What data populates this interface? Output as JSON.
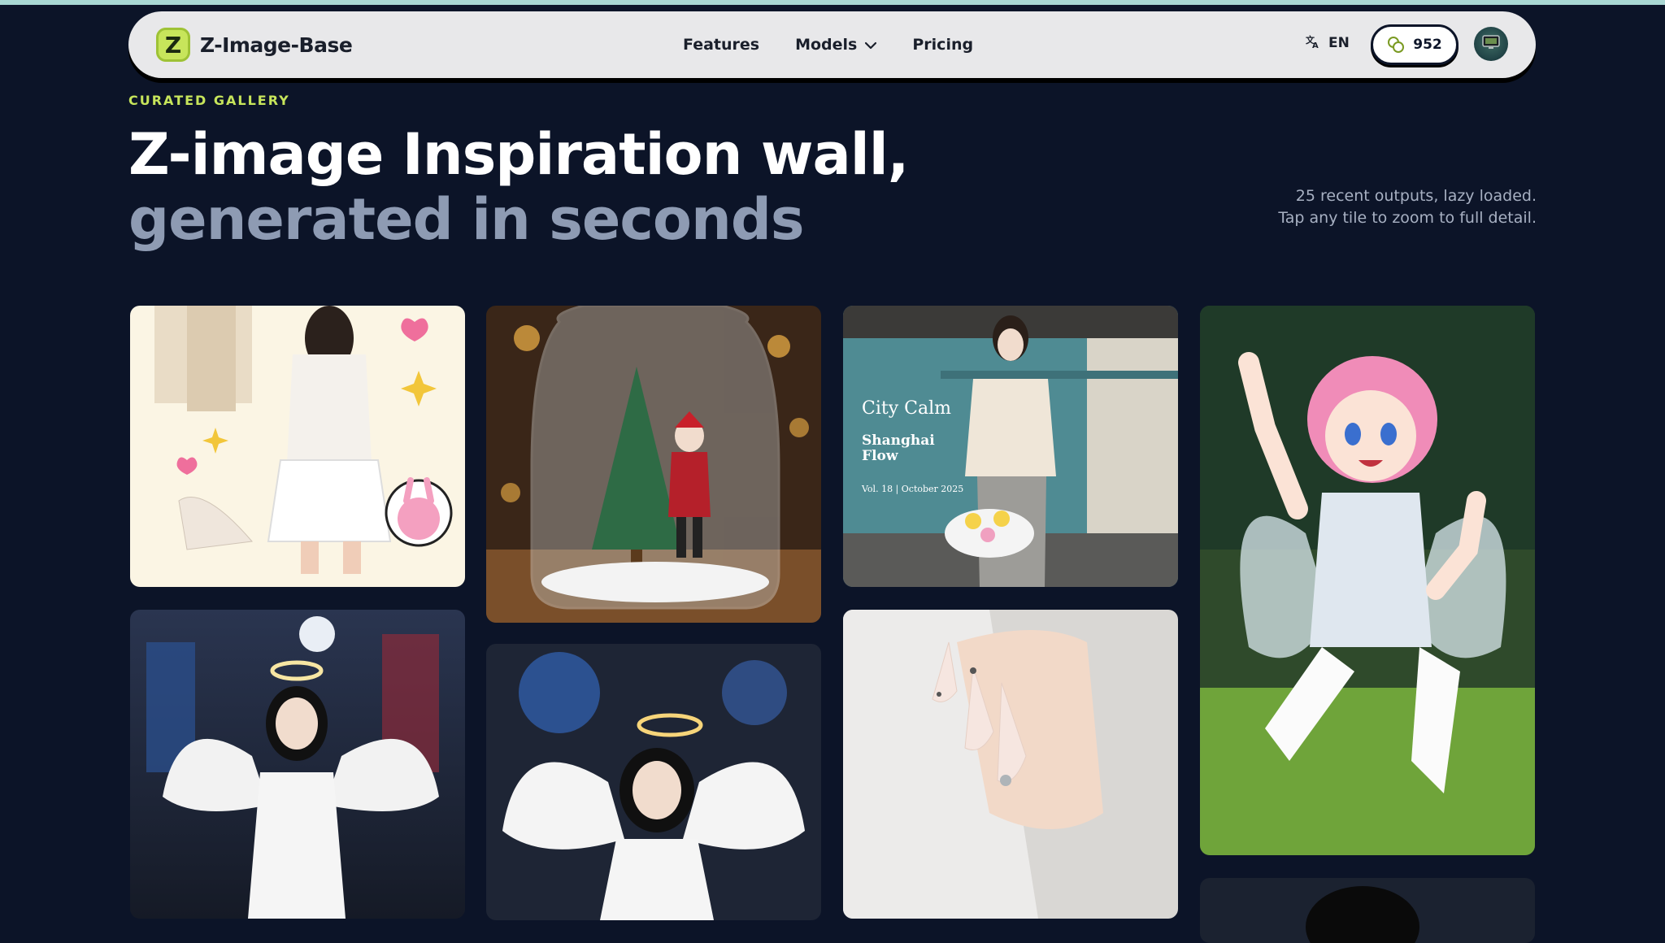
{
  "nav": {
    "brand": "Z-Image-Base",
    "logo_letter": "Z",
    "links": [
      {
        "label": "Features"
      },
      {
        "label": "Models"
      },
      {
        "label": "Pricing"
      }
    ],
    "language": "EN",
    "credits": "952"
  },
  "hero": {
    "kicker": "CURATED GALLERY",
    "title_main": "Z-image Inspiration wall, ",
    "title_muted": "generated in seconds",
    "note": "25 recent outputs, lazy loaded. Tap any tile to zoom to full detail."
  },
  "gallery": {
    "magazine": {
      "title": "City Calm",
      "subtitle": "Shanghai Flow",
      "issue": "Vol. 18 | October 2025"
    }
  },
  "colors": {
    "background": "#0c1428",
    "accent": "#c7e55b",
    "muted_heading": "#8e9bb3",
    "nav_bg": "#e8e8ea"
  },
  "icons": [
    "logo-icon",
    "chevron-down-icon",
    "translate-icon",
    "coins-icon",
    "avatar-icon"
  ]
}
